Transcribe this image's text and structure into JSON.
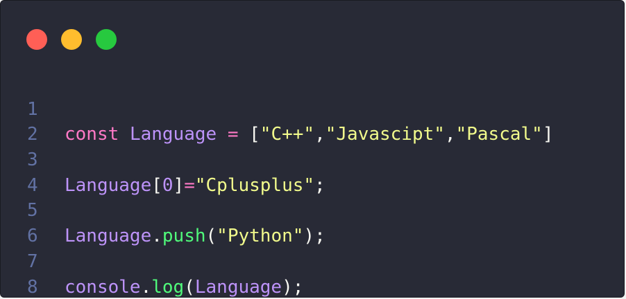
{
  "window": {
    "traffic_lights": [
      {
        "name": "close",
        "color": "#ff5f56"
      },
      {
        "name": "minimize",
        "color": "#ffbd2e"
      },
      {
        "name": "zoom",
        "color": "#27c93f"
      }
    ]
  },
  "code": {
    "line_numbers": [
      "1",
      "2",
      "3",
      "4",
      "5",
      "6",
      "7",
      "8"
    ],
    "line1": {
      "kw_const": "const",
      "sp1": " ",
      "ident": "Language",
      "sp2": " ",
      "op_eq": "=",
      "sp3": " ",
      "bracket_open": "[",
      "str1": "\"C++\"",
      "comma1": ",",
      "str2": "\"Javascipt\"",
      "comma2": ",",
      "str3": "\"Pascal\"",
      "bracket_close": "]"
    },
    "line3": {
      "ident": "Language",
      "bracket_open": "[",
      "index": "0",
      "bracket_close": "]",
      "op_eq": "=",
      "str": "\"Cplusplus\"",
      "semi": ";"
    },
    "line5": {
      "ident": "Language",
      "dot": ".",
      "method": "push",
      "paren_open": "(",
      "str": "\"Python\"",
      "paren_close": ")",
      "semi": ";"
    },
    "line7": {
      "obj": "console",
      "dot": ".",
      "method": "log",
      "paren_open": "(",
      "arg": "Language",
      "paren_close": ")",
      "semi": ";"
    }
  },
  "theme": {
    "background": "#282a36",
    "keyword": "#ff79c6",
    "identifier": "#bd93f9",
    "string": "#f1fa8c",
    "function": "#50fa7b",
    "punctuation": "#f8f8f2",
    "line_number": "#6272a4"
  }
}
